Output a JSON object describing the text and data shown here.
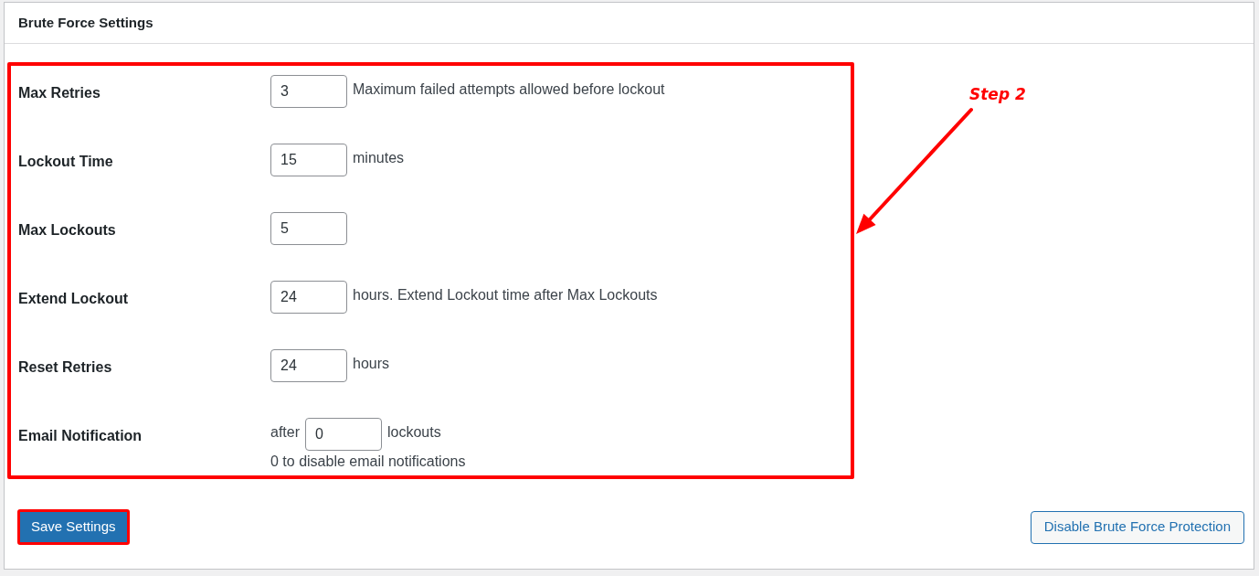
{
  "panel": {
    "title": "Brute Force Settings"
  },
  "settings": [
    {
      "label": "Max Retries",
      "value": "3",
      "suffix": "Maximum failed attempts allowed before lockout"
    },
    {
      "label": "Lockout Time",
      "value": "15",
      "suffix": "minutes"
    },
    {
      "label": "Max Lockouts",
      "value": "5"
    },
    {
      "label": "Extend Lockout",
      "value": "24",
      "suffix": "hours. Extend Lockout time after Max Lockouts"
    },
    {
      "label": "Reset Retries",
      "value": "24",
      "suffix": "hours"
    },
    {
      "label": "Email Notification",
      "prefix": "after",
      "value": "0",
      "suffix": "lockouts",
      "note": "0 to disable email notifications"
    }
  ],
  "annotation": {
    "label": "Step 2"
  },
  "buttons": [
    {
      "label": "Save Settings",
      "kind": "primary",
      "highlighted": true
    },
    {
      "label": "Disable Brute Force Protection",
      "kind": "secondary",
      "highlighted": false
    }
  ]
}
